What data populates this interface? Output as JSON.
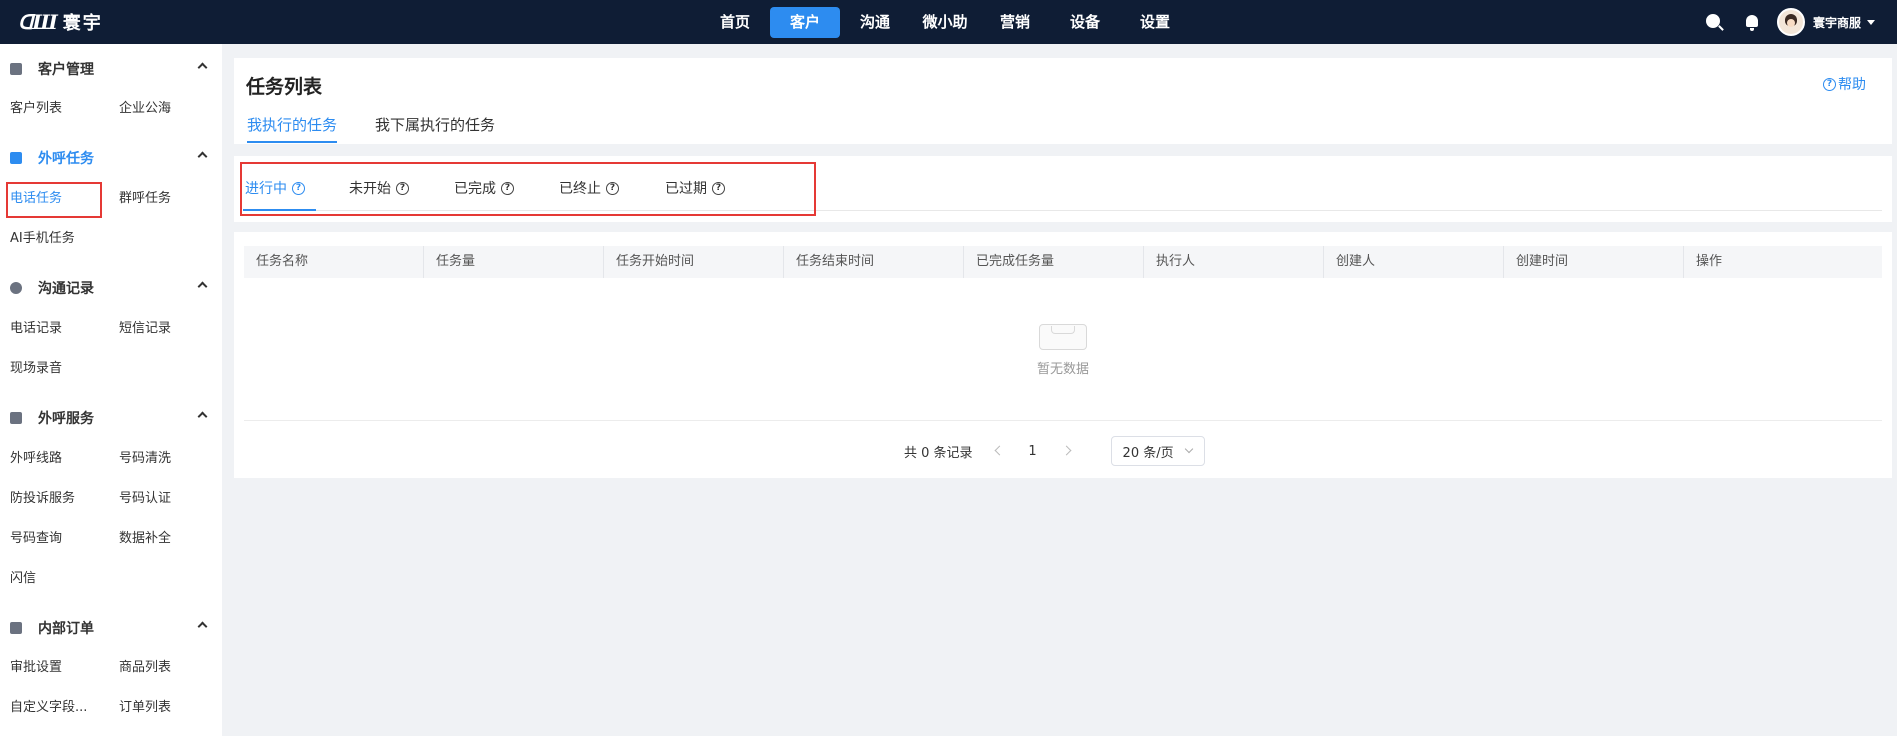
{
  "brand": {
    "mark": "ᗡШ",
    "name": "寰宇"
  },
  "topnav": [
    {
      "label": "首页",
      "active": false
    },
    {
      "label": "客户",
      "active": true
    },
    {
      "label": "沟通",
      "active": false
    },
    {
      "label": "微小助",
      "active": false
    },
    {
      "label": "营销",
      "active": false
    },
    {
      "label": "设备",
      "active": false
    },
    {
      "label": "设置",
      "active": false
    }
  ],
  "user": {
    "name": "寰宇商服"
  },
  "sidebar": {
    "groups": [
      {
        "title": "客户管理",
        "icon": "medal-icon",
        "items": [
          "客户列表",
          "企业公海"
        ]
      },
      {
        "title": "外呼任务",
        "icon": "phone-icon",
        "items": [
          "电话任务",
          "群呼任务",
          "AI手机任务"
        ],
        "active_item": "电话任务"
      },
      {
        "title": "沟通记录",
        "icon": "chat-icon",
        "items": [
          "电话记录",
          "短信记录",
          "现场录音"
        ]
      },
      {
        "title": "外呼服务",
        "icon": "briefcase-icon",
        "items": [
          "外呼线路",
          "号码清洗",
          "防投诉服务",
          "号码认证",
          "号码查询",
          "数据补全",
          "闪信"
        ]
      },
      {
        "title": "内部订单",
        "icon": "order-icon",
        "items": [
          "审批设置",
          "商品列表",
          "自定义字段...",
          "订单列表"
        ]
      }
    ]
  },
  "page": {
    "title": "任务列表",
    "help": "帮助",
    "help_glyph": "?",
    "tabs": [
      {
        "label": "我执行的任务",
        "active": true
      },
      {
        "label": "我下属执行的任务",
        "active": false
      }
    ]
  },
  "status_tabs": [
    {
      "label": "进行中",
      "active": true
    },
    {
      "label": "未开始",
      "active": false
    },
    {
      "label": "已完成",
      "active": false
    },
    {
      "label": "已终止",
      "active": false
    },
    {
      "label": "已过期",
      "active": false
    }
  ],
  "q_glyph": "?",
  "table": {
    "columns": [
      "任务名称",
      "任务量",
      "任务开始时间",
      "任务结束时间",
      "已完成任务量",
      "执行人",
      "创建人",
      "创建时间",
      "操作"
    ],
    "empty_text": "暂无数据"
  },
  "pagination": {
    "total_text": "共 0 条记录",
    "current_page": "1",
    "page_size": "20 条/页"
  },
  "colors": {
    "topbar": "#0f1d35",
    "accent": "#2d8cf0",
    "highlight_box": "#e53935"
  }
}
